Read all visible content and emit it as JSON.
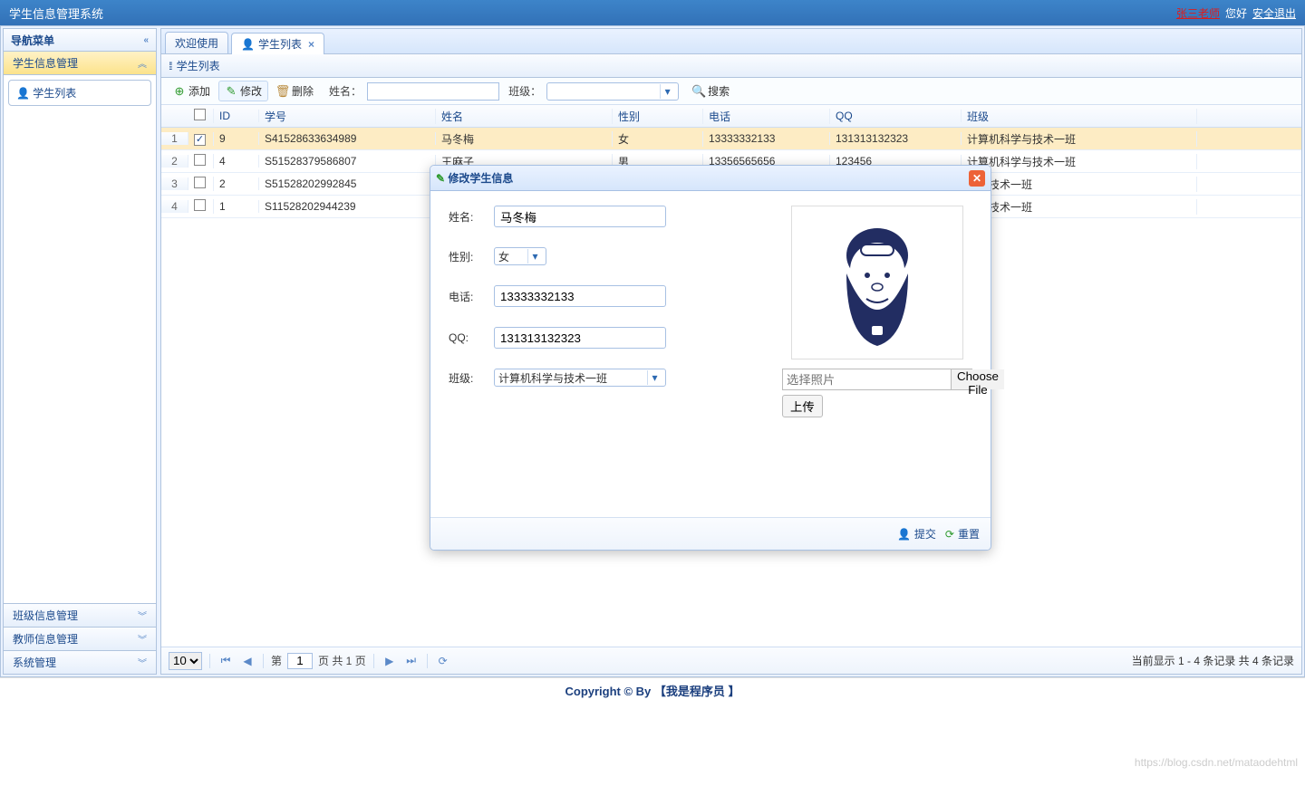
{
  "header": {
    "title": "学生信息管理系统",
    "user": "张三老师",
    "hello": "您好",
    "logout": "安全退出"
  },
  "sidebar": {
    "title": "导航菜单",
    "sections": [
      {
        "label": "学生信息管理",
        "active": true
      },
      {
        "label": "班级信息管理"
      },
      {
        "label": "教师信息管理"
      },
      {
        "label": "系统管理"
      }
    ],
    "nav_link": "学生列表"
  },
  "tabs": [
    {
      "label": "欢迎使用",
      "closable": false
    },
    {
      "label": "学生列表",
      "closable": true,
      "active": true
    }
  ],
  "subtitle": "学生列表",
  "toolbar": {
    "add": "添加",
    "edit": "修改",
    "del": "删除",
    "name_label": "姓名：",
    "name_value": "",
    "class_label": "班级：",
    "class_value": "",
    "search": "搜索"
  },
  "grid": {
    "columns": [
      "ID",
      "学号",
      "姓名",
      "性别",
      "电话",
      "QQ",
      "班级"
    ],
    "rows": [
      {
        "checked": true,
        "id": "9",
        "sno": "S41528633634989",
        "name": "马冬梅",
        "sex": "女",
        "tel": "13333332133",
        "qq": "131313132323",
        "cls": "计算机科学与技术一班"
      },
      {
        "checked": false,
        "id": "4",
        "sno": "S51528379586807",
        "name": "王麻子",
        "sex": "男",
        "tel": "13356565656",
        "qq": "123456",
        "cls": "计算机科学与技术一班"
      },
      {
        "checked": false,
        "id": "2",
        "sno": "S51528202992845",
        "name": "",
        "sex": "",
        "tel": "",
        "qq": "",
        "cls": "学与技术一班"
      },
      {
        "checked": false,
        "id": "1",
        "sno": "S11528202944239",
        "name": "",
        "sex": "",
        "tel": "",
        "qq": "",
        "cls": "学与技术一班"
      }
    ]
  },
  "pager": {
    "page_size": "10",
    "page_label_pre": "第",
    "page": "1",
    "page_label_post": "页 共 1 页",
    "info": "当前显示 1 - 4 条记录 共 4 条记录"
  },
  "dialog": {
    "title": "修改学生信息",
    "fields": {
      "name_label": "姓名:",
      "name": "马冬梅",
      "sex_label": "性别:",
      "sex": "女",
      "tel_label": "电话:",
      "tel": "13333332133",
      "qq_label": "QQ:",
      "qq": "131313132323",
      "cls_label": "班级:",
      "cls": "计算机科学与技术一班"
    },
    "photo_placeholder": "选择照片",
    "choose_file": "Choose File",
    "upload": "上传",
    "submit": "提交",
    "reset": "重置"
  },
  "footer": "Copyright © By 【我是程序员 】",
  "watermark": "https://blog.csdn.net/mataodehtml"
}
